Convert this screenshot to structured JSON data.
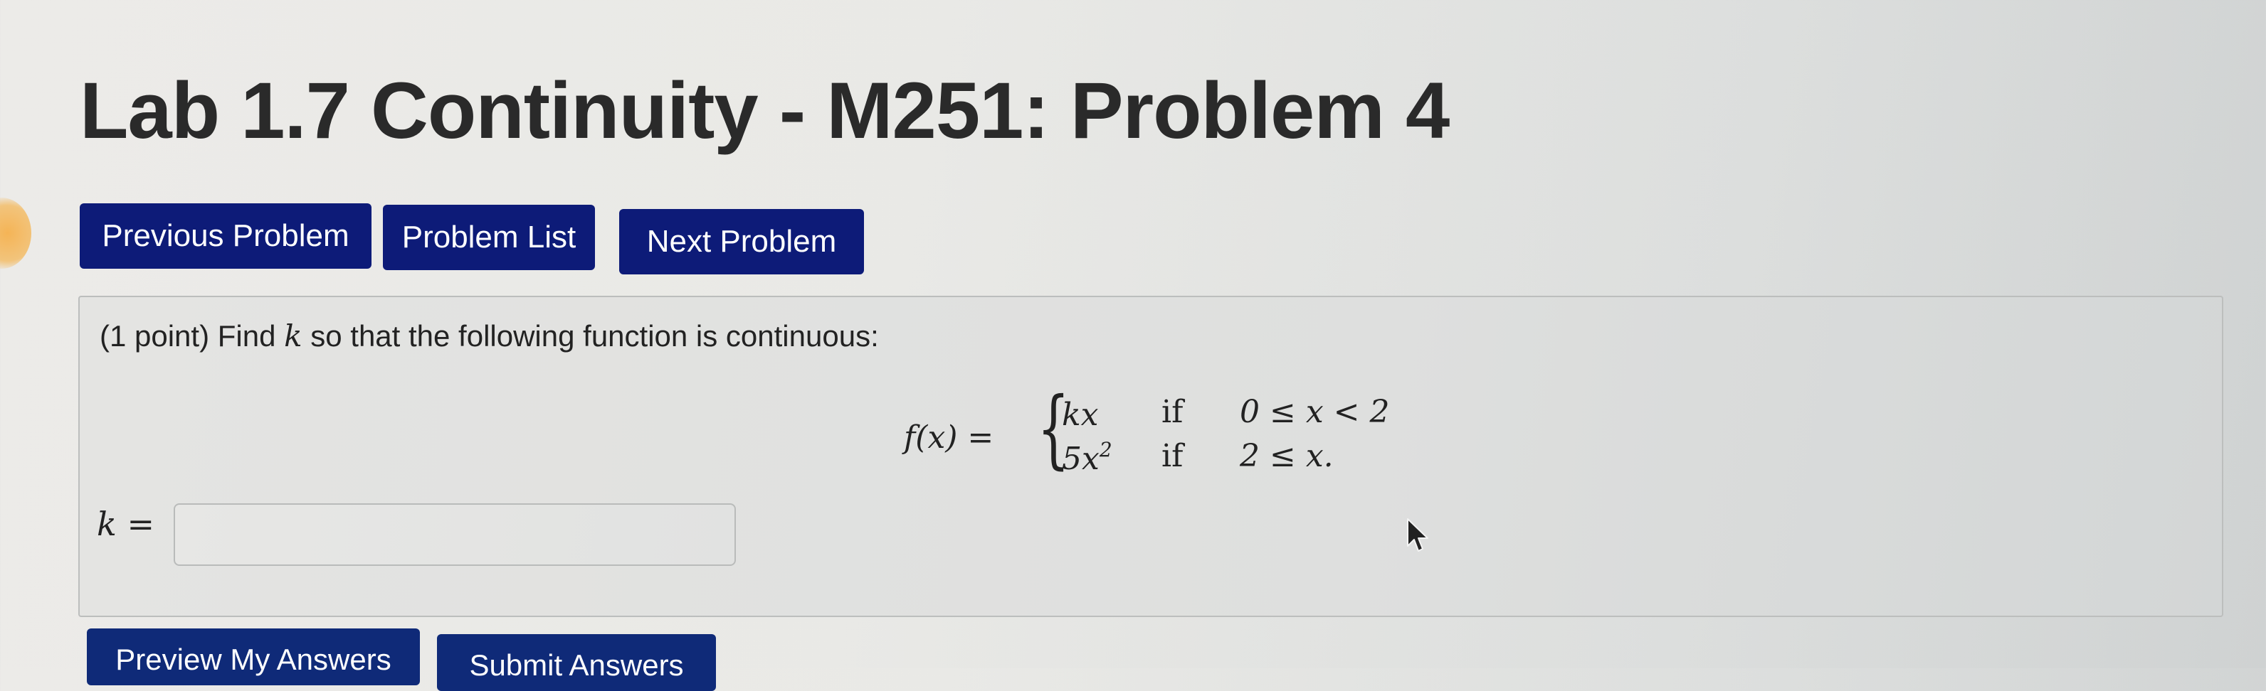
{
  "page": {
    "title": "Lab 1.7 Continuity - M251: Problem 4"
  },
  "nav": {
    "previous_label": "Previous Problem",
    "list_label": "Problem List",
    "next_label": "Next Problem"
  },
  "problem": {
    "points": "(1 point)",
    "statement_pre": " Find ",
    "variable": "k",
    "statement_post": " so that the following function is continuous:",
    "function_label": "f(x) =",
    "cases": [
      {
        "expr_base": "kx",
        "expr_exp": "",
        "if_word": "if",
        "condition": "0 ≤ x < 2"
      },
      {
        "expr_base": "5x",
        "expr_exp": "2",
        "if_word": "if",
        "condition": "2 ≤ x."
      }
    ]
  },
  "answer": {
    "label": "k =",
    "value": ""
  },
  "actions": {
    "preview_label": "Preview My Answers",
    "submit_label": "Submit Answers"
  },
  "colors": {
    "button_bg": "#0d1b78",
    "button_text": "#ffffff"
  }
}
